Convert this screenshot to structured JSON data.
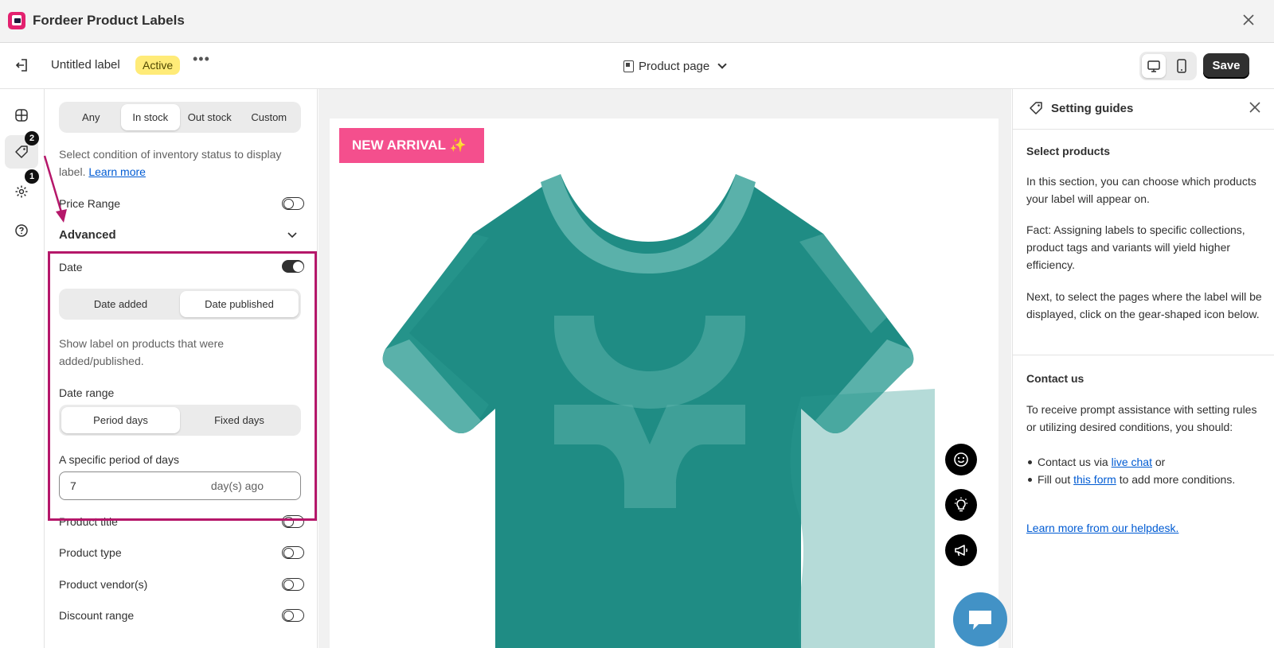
{
  "window": {
    "title": "Fordeer Product Labels"
  },
  "toolbar": {
    "label_name": "Untitled label",
    "status": "Active",
    "more": "•••",
    "page_selector": "Product page",
    "save_label": "Save",
    "device_selected": "desktop"
  },
  "rail": {
    "items": [
      {
        "icon": "layout-icon"
      },
      {
        "icon": "tag-icon",
        "badge": "2",
        "selected": true
      },
      {
        "icon": "gear-icon",
        "badge": "1"
      },
      {
        "icon": "help-icon"
      }
    ]
  },
  "panel": {
    "inventory_tabs": [
      "Any",
      "In stock",
      "Out stock",
      "Custom"
    ],
    "inventory_selected": "In stock",
    "inventory_help": "Select condition of inventory status to display label.",
    "learn_more": "Learn more",
    "price_range": {
      "label": "Price Range",
      "on": false
    },
    "advanced_title": "Advanced",
    "date": {
      "label": "Date",
      "on": true,
      "tabs": [
        "Date added",
        "Date published"
      ],
      "selected": "Date published",
      "help": "Show label on products that were added/published.",
      "range_label": "Date range",
      "range_tabs": [
        "Period days",
        "Fixed days"
      ],
      "range_selected": "Period days",
      "period_label": "A specific period of days",
      "period_value": "7",
      "period_suffix": "day(s) ago"
    },
    "toggles": [
      {
        "label": "Product title",
        "on": false
      },
      {
        "label": "Product type",
        "on": false
      },
      {
        "label": "Product vendor(s)",
        "on": false
      },
      {
        "label": "Discount range",
        "on": false
      }
    ]
  },
  "preview": {
    "badge_text": "NEW ARRIVAL ✨",
    "badge_color": "#f44f8d",
    "shirt_color": "#1f8c84",
    "shirt_trim": "#5ab1aa"
  },
  "guides": {
    "title": "Setting guides",
    "select_products_heading": "Select products",
    "p1": "In this section, you can choose which products your label will appear on.",
    "p2": "Fact: Assigning labels to specific collections, product tags and variants will yield higher efficiency.",
    "p3": "Next, to select the pages where the label will be displayed, click on the gear-shaped icon below.",
    "contact_heading": "Contact us",
    "contact_intro": "To receive prompt assistance with setting rules or utilizing desired conditions, you should:",
    "bullet1_prefix": "Contact us via",
    "bullet1_link": "live chat",
    "bullet1_suffix": "or",
    "bullet2_prefix": "Fill out",
    "bullet2_link": "this form",
    "bullet2_suffix": "to add more conditions.",
    "helpdesk_link": "Learn more from our helpdesk."
  }
}
